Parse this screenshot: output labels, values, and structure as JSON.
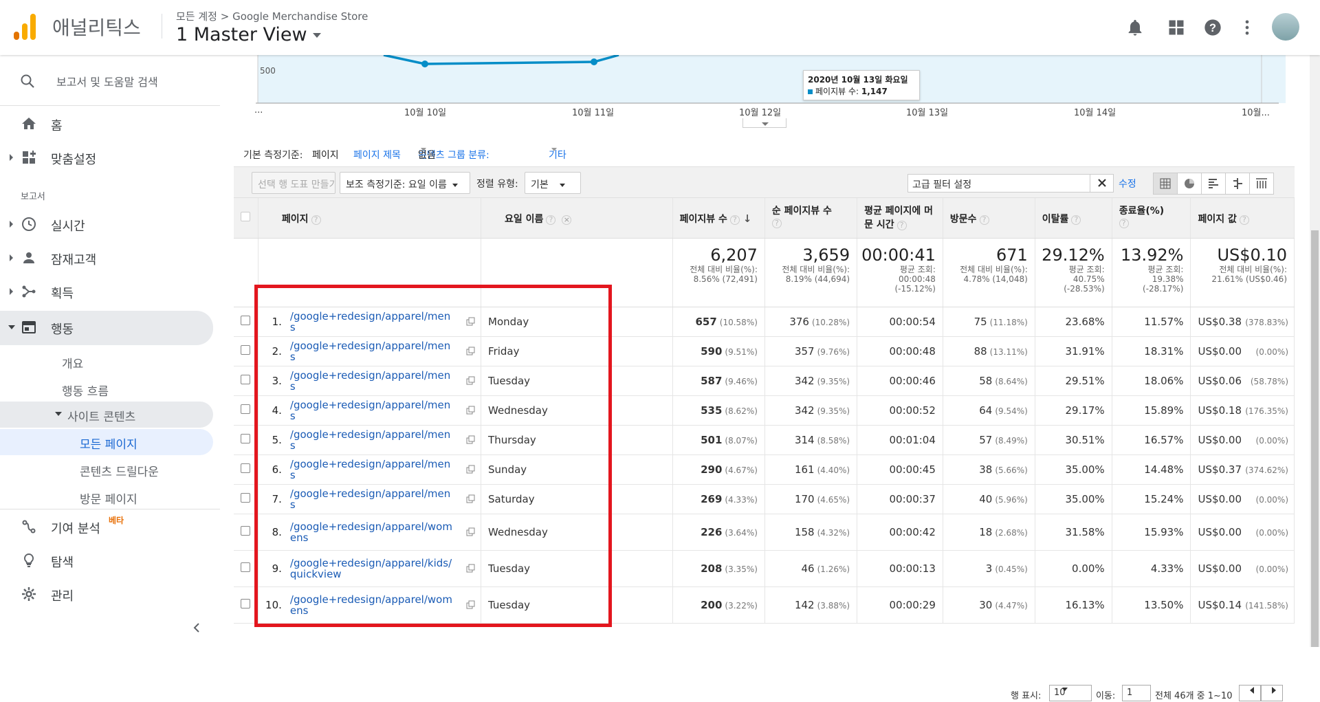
{
  "header": {
    "brand": "애널리틱스",
    "breadcrumb": "모든 계정 > Google Merchandise Store",
    "view_name": "1 Master View"
  },
  "sidebar": {
    "search_placeholder": "보고서 및 도움말 검색",
    "home": "홈",
    "customization": "맞춤설정",
    "reports_header": "보고서",
    "realtime": "실시간",
    "audience": "잠재고객",
    "acquisition": "획득",
    "behavior": "행동",
    "behavior_sub": {
      "overview": "개요",
      "flow": "행동 흐름",
      "site_content": "사이트 콘텐츠",
      "all_pages": "모든 페이지",
      "content_drilldown": "콘텐츠 드릴다운",
      "landing_pages": "방문 페이지"
    },
    "attribution": "기여 분석",
    "beta": "베타",
    "discover": "탐색",
    "admin": "관리"
  },
  "chart": {
    "y_tick": "500",
    "x_ticks": [
      "...",
      "10월 10일",
      "10월 11일",
      "10월 12일",
      "10월 13일",
      "10월 14일",
      "10월..."
    ],
    "tooltip_date": "2020년 10월 13일 화요일",
    "tooltip_metric": "페이지뷰 수:",
    "tooltip_value": "1,147",
    "line_color": "#058dc7"
  },
  "dimensions": {
    "label": "기본 측정기준:",
    "selected": "페이지",
    "page_title": "페이지 제목",
    "content_group": "콘텐츠 그룹 분류:",
    "content_group_value": "없음",
    "other": "기타"
  },
  "toolbar": {
    "make_chart": "선택 행 도표 만들기",
    "secondary_dim": "보조 측정기준: 요일 이름",
    "sort_label": "정렬 유형:",
    "sort_value": "기본",
    "filter_value": "고급 필터 설정",
    "edit": "수정"
  },
  "table": {
    "headers": {
      "page": "페이지",
      "day": "요일 이름",
      "pageviews": "페이지뷰 수",
      "unique_pageviews": "순 페이지뷰 수",
      "avg_time": "평균 페이지에 머문 시간",
      "entrances": "방문수",
      "bounce_rate": "이탈률",
      "exit_rate": "종료율(%)",
      "page_value": "페이지 값"
    },
    "totals": {
      "pageviews": "6,207",
      "pageviews_sub1": "전체 대비 비율(%):",
      "pageviews_sub2": "8.56% (72,491)",
      "unique_pageviews": "3,659",
      "unique_sub1": "전체 대비 비율(%):",
      "unique_sub2": "8.19% (44,694)",
      "avg_time": "00:00:41",
      "avg_time_sub1": "평균 조회:",
      "avg_time_sub2": "00:00:48",
      "avg_time_sub3": "(-15.12%)",
      "entrances": "671",
      "entrances_sub1": "전체 대비 비율(%):",
      "entrances_sub2": "4.78% (14,048)",
      "bounce": "29.12%",
      "bounce_sub1": "평균 조회:",
      "bounce_sub2": "40.75%",
      "bounce_sub3": "(-28.53%)",
      "exit": "13.92%",
      "exit_sub1": "평균 조회:",
      "exit_sub2": "19.38%",
      "exit_sub3": "(-28.17%)",
      "value": "US$0.10",
      "value_sub1": "전체 대비 비율(%):",
      "value_sub2": "21.61% (US$0.46)"
    },
    "rows": [
      {
        "idx": "1.",
        "page": "/google+redesign/apparel/mens",
        "day": "Monday",
        "pv": "657",
        "pv_pct": "(10.58%)",
        "upv": "376",
        "upv_pct": "(10.28%)",
        "time": "00:00:54",
        "ent": "75",
        "ent_pct": "(11.18%)",
        "bounce": "23.68%",
        "exit": "11.57%",
        "value": "US$0.38",
        "value_pct": "(378.83%)"
      },
      {
        "idx": "2.",
        "page": "/google+redesign/apparel/mens",
        "day": "Friday",
        "pv": "590",
        "pv_pct": "(9.51%)",
        "upv": "357",
        "upv_pct": "(9.76%)",
        "time": "00:00:48",
        "ent": "88",
        "ent_pct": "(13.11%)",
        "bounce": "31.91%",
        "exit": "18.31%",
        "value": "US$0.00",
        "value_pct": "(0.00%)"
      },
      {
        "idx": "3.",
        "page": "/google+redesign/apparel/mens",
        "day": "Tuesday",
        "pv": "587",
        "pv_pct": "(9.46%)",
        "upv": "342",
        "upv_pct": "(9.35%)",
        "time": "00:00:46",
        "ent": "58",
        "ent_pct": "(8.64%)",
        "bounce": "29.51%",
        "exit": "18.06%",
        "value": "US$0.06",
        "value_pct": "(58.78%)"
      },
      {
        "idx": "4.",
        "page": "/google+redesign/apparel/mens",
        "day": "Wednesday",
        "pv": "535",
        "pv_pct": "(8.62%)",
        "upv": "342",
        "upv_pct": "(9.35%)",
        "time": "00:00:52",
        "ent": "64",
        "ent_pct": "(9.54%)",
        "bounce": "29.17%",
        "exit": "15.89%",
        "value": "US$0.18",
        "value_pct": "(176.35%)"
      },
      {
        "idx": "5.",
        "page": "/google+redesign/apparel/mens",
        "day": "Thursday",
        "pv": "501",
        "pv_pct": "(8.07%)",
        "upv": "314",
        "upv_pct": "(8.58%)",
        "time": "00:01:04",
        "ent": "57",
        "ent_pct": "(8.49%)",
        "bounce": "30.51%",
        "exit": "16.57%",
        "value": "US$0.00",
        "value_pct": "(0.00%)"
      },
      {
        "idx": "6.",
        "page": "/google+redesign/apparel/mens",
        "day": "Sunday",
        "pv": "290",
        "pv_pct": "(4.67%)",
        "upv": "161",
        "upv_pct": "(4.40%)",
        "time": "00:00:45",
        "ent": "38",
        "ent_pct": "(5.66%)",
        "bounce": "35.00%",
        "exit": "14.48%",
        "value": "US$0.37",
        "value_pct": "(374.62%)"
      },
      {
        "idx": "7.",
        "page": "/google+redesign/apparel/mens",
        "day": "Saturday",
        "pv": "269",
        "pv_pct": "(4.33%)",
        "upv": "170",
        "upv_pct": "(4.65%)",
        "time": "00:00:37",
        "ent": "40",
        "ent_pct": "(5.96%)",
        "bounce": "35.00%",
        "exit": "15.24%",
        "value": "US$0.00",
        "value_pct": "(0.00%)"
      },
      {
        "idx": "8.",
        "page": "/google+redesign/apparel/womens",
        "day": "Wednesday",
        "pv": "226",
        "pv_pct": "(3.64%)",
        "upv": "158",
        "upv_pct": "(4.32%)",
        "time": "00:00:42",
        "ent": "18",
        "ent_pct": "(2.68%)",
        "bounce": "31.58%",
        "exit": "15.93%",
        "value": "US$0.00",
        "value_pct": "(0.00%)"
      },
      {
        "idx": "9.",
        "page": "/google+redesign/apparel/kids/quickview",
        "day": "Tuesday",
        "pv": "208",
        "pv_pct": "(3.35%)",
        "upv": "46",
        "upv_pct": "(1.26%)",
        "time": "00:00:13",
        "ent": "3",
        "ent_pct": "(0.45%)",
        "bounce": "0.00%",
        "exit": "4.33%",
        "value": "US$0.00",
        "value_pct": "(0.00%)"
      },
      {
        "idx": "10.",
        "page": "/google+redesign/apparel/womens",
        "day": "Tuesday",
        "pv": "200",
        "pv_pct": "(3.22%)",
        "upv": "142",
        "upv_pct": "(3.88%)",
        "time": "00:00:29",
        "ent": "30",
        "ent_pct": "(4.47%)",
        "bounce": "16.13%",
        "exit": "13.50%",
        "value": "US$0.14",
        "value_pct": "(141.58%)"
      }
    ]
  },
  "pager": {
    "show_rows": "행 표시:",
    "rows_value": "10",
    "goto": "이동:",
    "goto_value": "1",
    "range": "전체 46개 중 1~10"
  },
  "colors": {
    "accent": "#1a73e8",
    "highlight": "#e3161e",
    "logo_orange": "#f9ab00",
    "logo_dark": "#e37400"
  }
}
